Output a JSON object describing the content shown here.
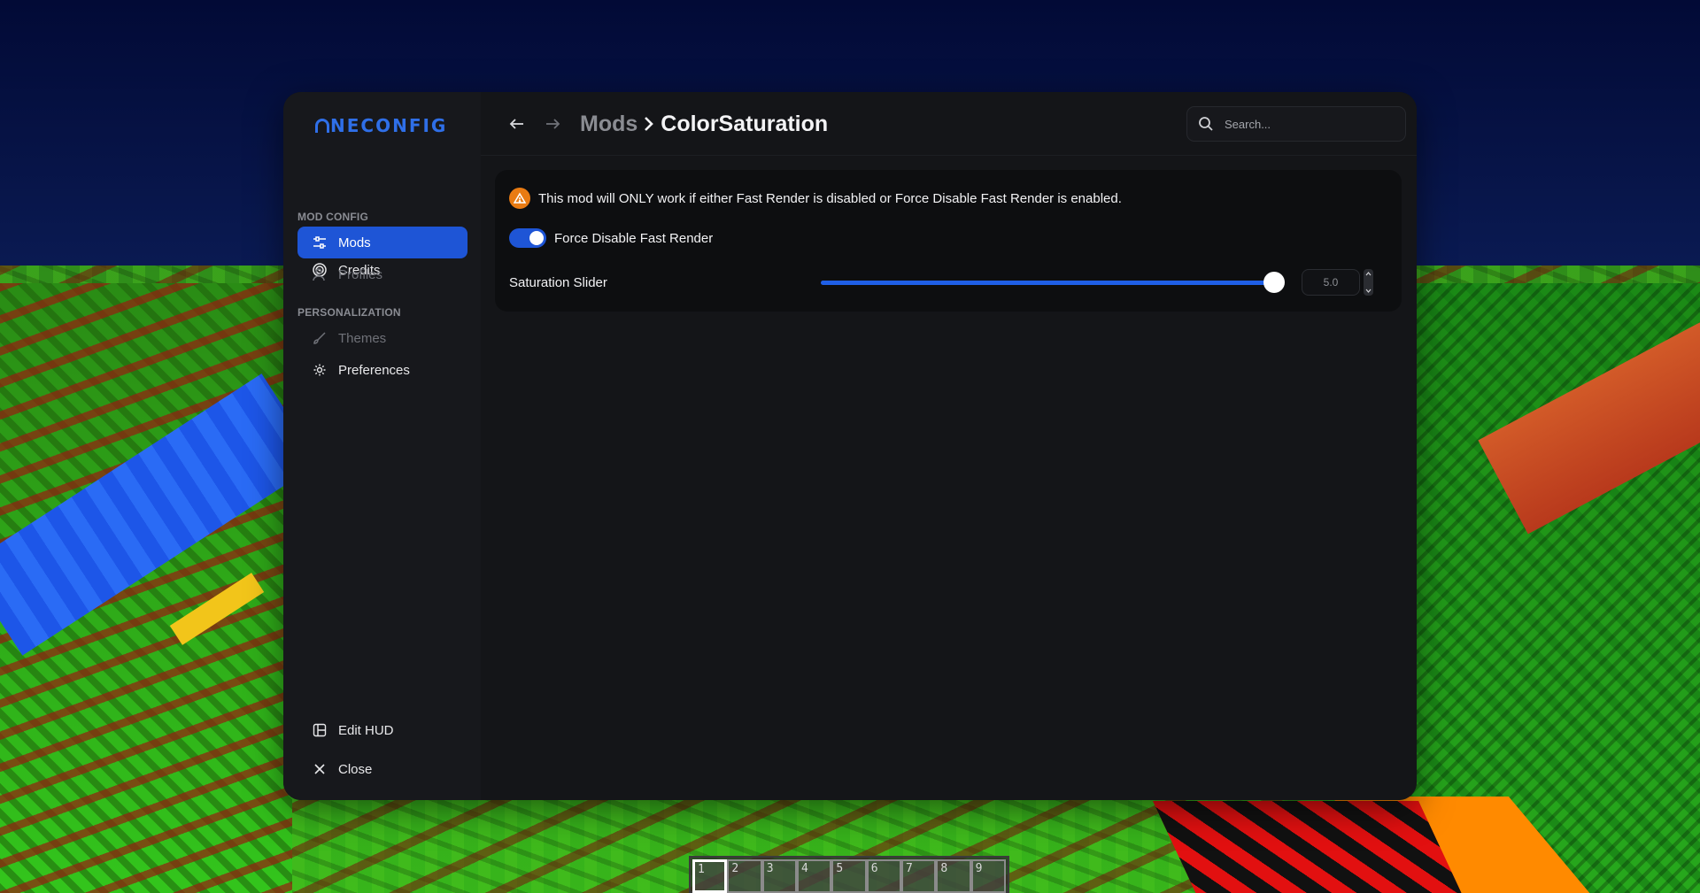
{
  "app": {
    "logo_text": "NECONFIG",
    "brand_color": "#2f6fe8"
  },
  "sidebar": {
    "items": [
      {
        "label": "Credits",
        "icon": "target-icon"
      },
      {
        "label": "Mods",
        "icon": "sliders-icon",
        "active": true
      },
      {
        "label": "Profiles",
        "icon": "user-icon"
      },
      {
        "label": "Themes",
        "icon": "brush-icon"
      },
      {
        "label": "Preferences",
        "icon": "gear-icon"
      }
    ],
    "sections": {
      "mod_config": "MOD CONFIG",
      "personalization": "PERSONALIZATION"
    },
    "bottom": {
      "edit_hud": "Edit HUD",
      "close": "Close"
    }
  },
  "header": {
    "breadcrumb_parent": "Mods",
    "breadcrumb_current": "ColorSaturation"
  },
  "search": {
    "placeholder": "Search..."
  },
  "config": {
    "warning_text": "This mod will ONLY work if either Fast Render is disabled or Force Disable Fast Render is enabled.",
    "toggle_label": "Force Disable Fast Render",
    "toggle_on": true,
    "slider_label": "Saturation Slider",
    "slider_value_text": "5.0",
    "slider_fraction": 1.0
  },
  "hotbar": {
    "slots": [
      "1",
      "2",
      "3",
      "4",
      "5",
      "6",
      "7",
      "8",
      "9"
    ],
    "selected": "1"
  },
  "colors": {
    "accent": "#1e55d6",
    "warning": "#e97b12"
  }
}
